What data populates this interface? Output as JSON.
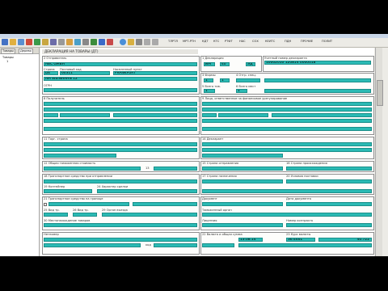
{
  "toolbar": {
    "info": [
      "ТЛРТЛ",
      "МРТ-РТН",
      "КДТ",
      "КТС",
      "РТФТ",
      "НАС",
      "СОХ",
      "КЕИТС",
      "ПДН",
      "ПРОЧИЕ",
      "ПОЛИТ"
    ]
  },
  "leftpanel": {
    "tabs": [
      "Товары",
      "Дерево"
    ],
    "tree": [
      "Товары",
      "1"
    ]
  },
  "doc": {
    "title": "ДЕКЛАРАЦИЯ НА ТОВАРЫ (ДТ)",
    "sender_label": "2 Отправитель",
    "sender_name": "ABC GMBH",
    "sender_country": "DE",
    "sender_zip": "60311",
    "sender_city": "FRANKFURT",
    "sender_street": "AM WEINHAHN 12",
    "decl_label": "1 Декларация",
    "decl_type1": "ИМ",
    "decl_type2": "40",
    "decl_type3": "ЭД",
    "reg_label": "Учетный номер декларанта",
    "reg_number": "10002010 120814 0000018",
    "forms_label": "3 Формы",
    "forms_val": "1",
    "forms_val2": "1",
    "spec_label": "4 Отгр. спец.",
    "items_label": "5 Всего тов.",
    "items_val": "1",
    "places_label": "6 Всего мест",
    "places_val": "1",
    "recipient_label": "8 Получатель",
    "fin_label": "9 Лицо, ответственное за финансовое урегулирование",
    "country_label": "Страна",
    "zip_label": "Почтовый код",
    "city_label": "Населенный пункт",
    "street_label": "Улица",
    "ogrn_label": "ОГРН",
    "decl14_label": "14 Декларант",
    "trade_label": "11 Торг. страна",
    "cost_label": "12 Общая таможенная стоимость",
    "code_13": "13",
    "dispatch_label": "15 Страна отправления",
    "origin_label": "16 Страна происхождения",
    "dest_label": "17 Страна назначения",
    "container_label": "19 Контейнер",
    "delivery_label": "20 Условия поставки",
    "currency_label": "22 Валюта и общая сумма",
    "rate_label": "23 Курс валюты",
    "date_val": "13.08.14",
    "rate_val": "36.4461",
    "sum_val": "40.722",
    "flow_label": "Нетномер",
    "transport_label": "18 Транспортное средство при отправлении",
    "border_label": "21 Транспортное средство на границе",
    "mode25_label": "25 Вид тр.",
    "mode26_label": "26 Вид тр.",
    "place29_label": "29 Орган въезда",
    "goods_label": "30 Местонахождение товаров",
    "bank_label": "24 Характер сделки",
    "docs_label": "Документ",
    "valid_label": "Дата документа",
    "office_label": "Таможенный орган",
    "license_label": "Лицензия",
    "totals_label": "Номер контракта",
    "code_val": "код"
  }
}
